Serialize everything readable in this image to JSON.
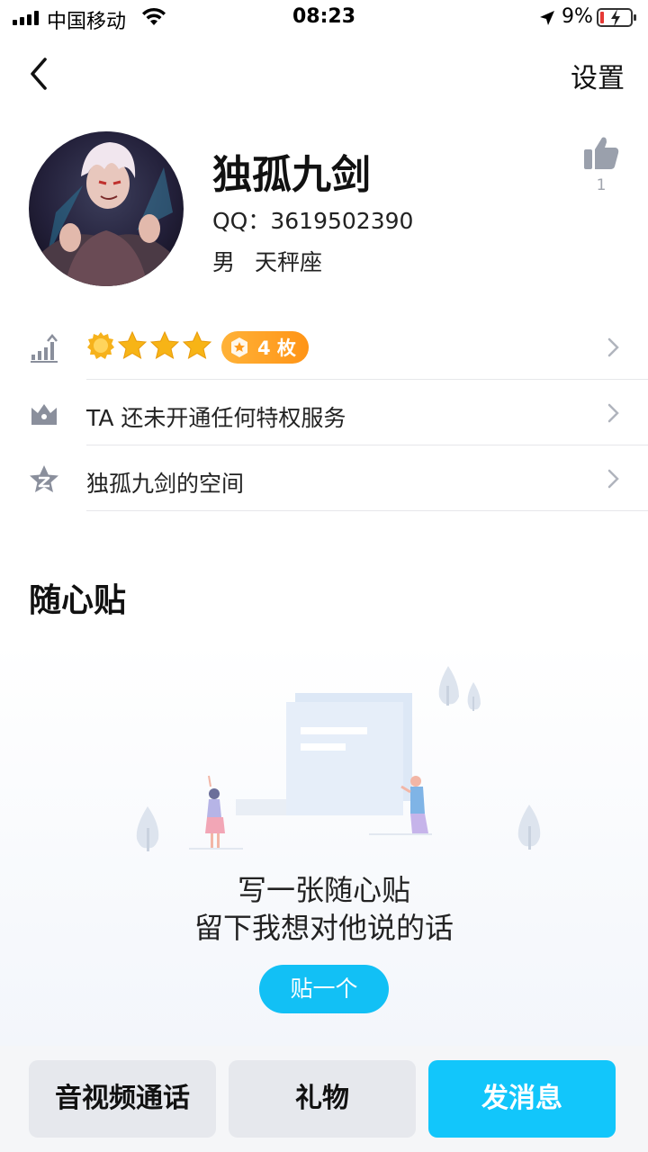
{
  "status_bar": {
    "carrier": "中国移动",
    "time": "08:23",
    "battery": "9%"
  },
  "nav": {
    "back_icon": "chevron-left-icon",
    "settings_label": "设置"
  },
  "profile": {
    "name": "独孤九剑",
    "qq_label": "QQ",
    "qq_separator": "：",
    "qq_number": "3619502390",
    "gender": "男",
    "zodiac": "天秤座",
    "like_count": "1"
  },
  "rows": [
    {
      "icon": "level-chart-icon",
      "medal_count": "4 枚"
    },
    {
      "icon": "crown-icon",
      "label": "TA 还未开通任何特权服务"
    },
    {
      "icon": "qzone-star-icon",
      "label": "独孤九剑的空间"
    }
  ],
  "sticky_notes": {
    "title": "随心贴",
    "empty_line1": "写一张随心贴",
    "empty_line2": "留下我想对他说的话",
    "post_button": "贴一个"
  },
  "bottom_bar": {
    "call_label": "音视频通话",
    "gift_label": "礼物",
    "message_label": "发消息"
  },
  "colors": {
    "accent": "#12c6fb",
    "medal_badge": "#ff9f1f",
    "icon_gray": "#8a8f9c"
  }
}
